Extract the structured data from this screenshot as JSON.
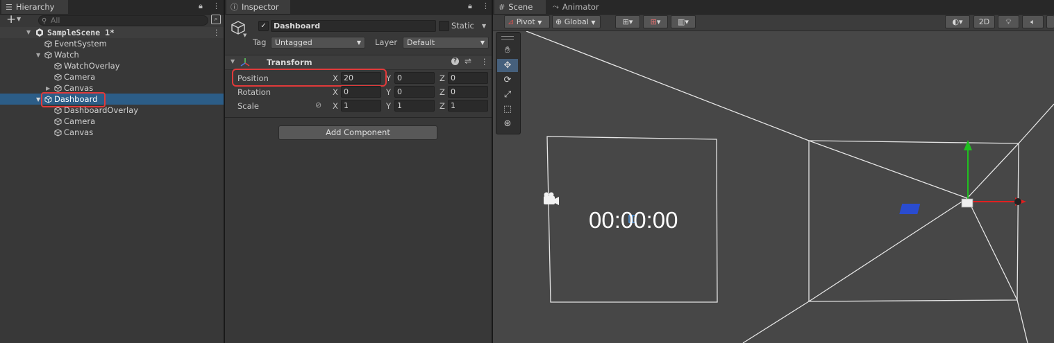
{
  "hierarchy": {
    "tab_label": "Hierarchy",
    "add_label": "+",
    "search_placeholder": "All",
    "scene_name": "SampleScene 1*",
    "items": [
      {
        "label": "EventSystem"
      },
      {
        "label": "Watch"
      },
      {
        "label": "WatchOverlay"
      },
      {
        "label": "Camera"
      },
      {
        "label": "Canvas"
      },
      {
        "label": "Dashboard"
      },
      {
        "label": "DashboardOverlay"
      },
      {
        "label": "Camera"
      },
      {
        "label": "Canvas"
      }
    ]
  },
  "inspector": {
    "tab_label": "Inspector",
    "object_name": "Dashboard",
    "static_label": "Static",
    "tag_label": "Tag",
    "tag_value": "Untagged",
    "layer_label": "Layer",
    "layer_value": "Default",
    "component_title": "Transform",
    "position_label": "Position",
    "rotation_label": "Rotation",
    "scale_label": "Scale",
    "axis_x": "X",
    "axis_y": "Y",
    "axis_z": "Z",
    "position": {
      "x": "20",
      "y": "0",
      "z": "0"
    },
    "rotation": {
      "x": "0",
      "y": "0",
      "z": "0"
    },
    "scale": {
      "x": "1",
      "y": "1",
      "z": "1"
    },
    "add_component_label": "Add Component"
  },
  "scene": {
    "tab_scene": "Scene",
    "tab_animator": "Animator",
    "pivot_label": "Pivot",
    "global_label": "Global",
    "mode_2d_label": "2D",
    "overlay_time": "00:00:00"
  },
  "colors": {
    "highlight": "#e23a3a",
    "selection": "#2c5d87",
    "gizmo_x": "#e02020",
    "gizmo_y": "#20c020",
    "gizmo_z": "#2a4cd0"
  }
}
